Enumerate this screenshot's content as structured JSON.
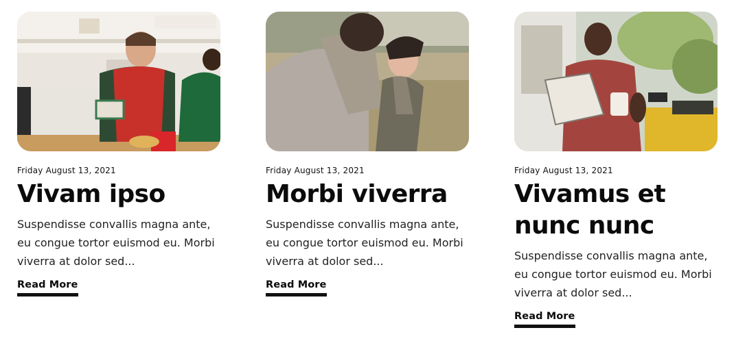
{
  "posts": [
    {
      "date": "Friday August 13, 2021",
      "title": "Vivam ipso",
      "excerpt": "Suspendisse convallis magna ante, eu congue tortor euismod eu. Morbi viverra at dolor sed...",
      "cta": "Read More",
      "image": "office-party-gift-photo"
    },
    {
      "date": "Friday August 13, 2021",
      "title": "Morbi viverra",
      "excerpt": "Suspendisse convallis magna ante, eu congue tortor euismod eu. Morbi viverra at dolor sed...",
      "cta": "Read More",
      "image": "friends-laughing-outdoors-photo"
    },
    {
      "date": "Friday August 13, 2021",
      "title": "Vivamus et nunc nunc",
      "excerpt": "Suspendisse convallis magna ante, eu congue tortor euismod eu. Morbi viverra at dolor sed...",
      "cta": "Read More",
      "image": "man-reading-newspaper-photo"
    }
  ]
}
